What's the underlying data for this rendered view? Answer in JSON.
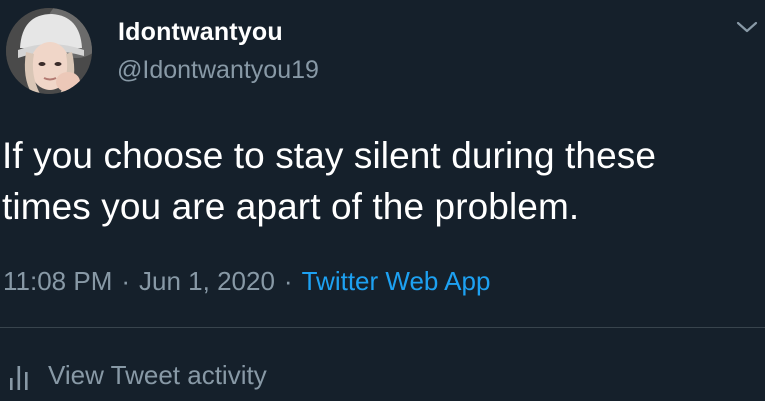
{
  "user": {
    "display_name": "Idontwantyou",
    "handle": "@Idontwantyou19",
    "avatar_icon": "user-avatar"
  },
  "tweet": {
    "text": "If you choose to stay silent during these times you are apart of the problem.",
    "time": "11:08 PM",
    "separator": "·",
    "date": "Jun 1, 2020",
    "source": "Twitter Web App"
  },
  "actions": {
    "menu_icon": "chevron-down-icon",
    "activity_icon": "bar-chart-icon",
    "activity_label": "View Tweet activity"
  },
  "colors": {
    "background": "#15202b",
    "text_primary": "#ffffff",
    "text_secondary": "#8899a6",
    "accent": "#1da1f2",
    "divider": "#38444d"
  }
}
